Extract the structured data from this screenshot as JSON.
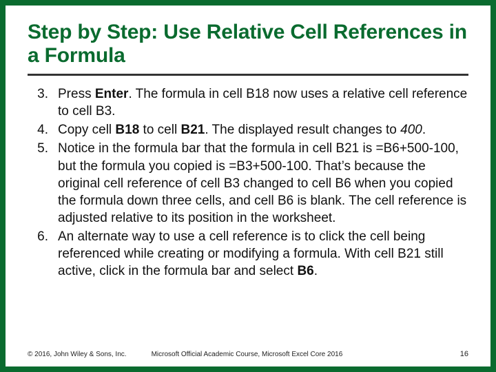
{
  "title": "Step by Step: Use Relative Cell References in a Formula",
  "steps": [
    {
      "num": "3.",
      "parts": [
        {
          "t": "Press "
        },
        {
          "t": "Enter",
          "b": true
        },
        {
          "t": ". The formula in cell B18 now uses a relative cell reference to cell B3."
        }
      ]
    },
    {
      "num": "4.",
      "parts": [
        {
          "t": "Copy cell "
        },
        {
          "t": "B18",
          "b": true
        },
        {
          "t": " to cell "
        },
        {
          "t": "B21",
          "b": true
        },
        {
          "t": ". The displayed result changes to "
        },
        {
          "t": "400",
          "i": true
        },
        {
          "t": "."
        }
      ]
    },
    {
      "num": "5.",
      "parts": [
        {
          "t": "Notice in the formula bar that the formula in cell B21 is =B6+500-100, but the formula you copied is =B3+500-100. That’s because the original cell reference of cell B3 changed to cell B6 when you copied the formula down three cells, and cell B6 is blank. The cell reference is adjusted relative to its position in the worksheet."
        }
      ]
    },
    {
      "num": "6.",
      "parts": [
        {
          "t": "An alternate way to use a cell reference is to click the cell being referenced while creating or modifying a formula. With cell B21 still active, click in the formula bar and select "
        },
        {
          "t": "B6",
          "b": true
        },
        {
          "t": "."
        }
      ]
    }
  ],
  "footer": {
    "copyright": "© 2016, John Wiley & Sons, Inc.",
    "course": "Microsoft Official Academic Course, Microsoft Excel Core 2016",
    "page": "16"
  }
}
